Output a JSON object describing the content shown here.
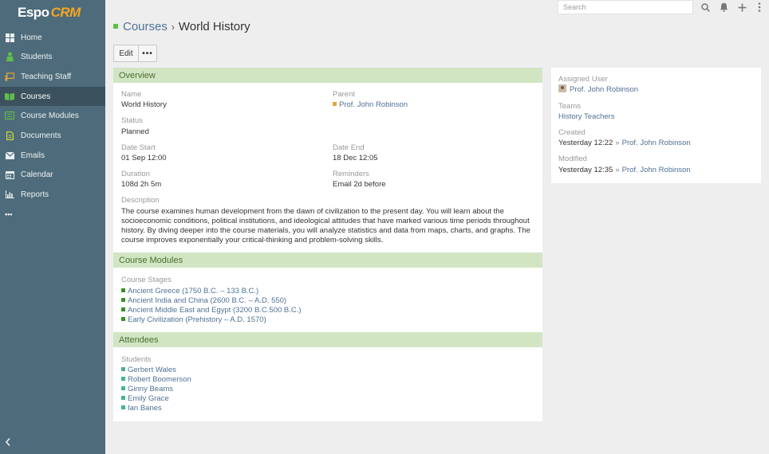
{
  "app": {
    "logo_part1": "Espo",
    "logo_part2": "CRM"
  },
  "sidebar": {
    "items": [
      {
        "label": "Home",
        "icon": "home-icon"
      },
      {
        "label": "Students",
        "icon": "student-icon"
      },
      {
        "label": "Teaching Staff",
        "icon": "teacher-icon"
      },
      {
        "label": "Courses",
        "icon": "book-icon",
        "active": true
      },
      {
        "label": "Course Modules",
        "icon": "module-icon"
      },
      {
        "label": "Documents",
        "icon": "document-icon"
      },
      {
        "label": "Emails",
        "icon": "email-icon"
      },
      {
        "label": "Calendar",
        "icon": "calendar-icon"
      },
      {
        "label": "Reports",
        "icon": "chart-icon"
      }
    ],
    "more_label": "•••",
    "collapse_label": "‹"
  },
  "topbar": {
    "search_placeholder": "Search"
  },
  "header": {
    "breadcrumb_parent": "Courses",
    "breadcrumb_separator": "›",
    "title": "World History",
    "edit_label": "Edit",
    "more_label": "•••"
  },
  "overview": {
    "panel_title": "Overview",
    "name_label": "Name",
    "name_value": "World History",
    "parent_label": "Parent",
    "parent_value": "Prof. John Robinson",
    "status_label": "Status",
    "status_value": "Planned",
    "date_start_label": "Date Start",
    "date_start_value": "01 Sep 12:00",
    "date_end_label": "Date End",
    "date_end_value": "18 Dec 12:05",
    "duration_label": "Duration",
    "duration_value": "108d 2h 5m",
    "reminders_label": "Reminders",
    "reminders_value": "Email 2d before",
    "description_label": "Description",
    "description_value": "The course examines human development from the dawn of civilization to the present day. You will learn about the socioeconomic conditions, political institutions, and ideological attitudes that have marked various time periods throughout history. By diving deeper into the course materials, you will analyze statistics and data from maps, charts, and graphs. The course improves exponentially your critical-thinking and problem-solving skills."
  },
  "course_modules": {
    "panel_title": "Course Modules",
    "stages_label": "Course Stages",
    "stages": [
      "Ancient Greece (1750 B.C. – 133 B.C.)",
      "Ancient India and China (2600 B.C. – A.D. 550)",
      "Ancient Middle East and Egypt (3200 B.C.500 B.C.)",
      "Early Civilization (Prehistory – A.D. 1570)"
    ]
  },
  "attendees": {
    "panel_title": "Attendees",
    "students_label": "Students",
    "students": [
      "Gerbert Wales",
      "Robert Boomerson",
      "Ginny Beams",
      "Emily Grace",
      "Ian Banes"
    ]
  },
  "side": {
    "assigned_user_label": "Assigned User",
    "assigned_user_value": "Prof. John Robinson",
    "teams_label": "Teams",
    "teams_value": "History Teachers",
    "created_label": "Created",
    "created_time": "Yesterday 12:22",
    "created_by": "Prof. John Robinson",
    "modified_label": "Modified",
    "modified_time": "Yesterday 12:35",
    "modified_by": "Prof. John Robinson",
    "by_separator": "»"
  },
  "colors": {
    "sidebar_bg": "#4d6b7a",
    "sidebar_active": "#3b525e",
    "panel_header": "#d1e5c3",
    "link": "#4f7196",
    "accent_green": "#5fbf4a",
    "logo_orange": "#f5a623"
  }
}
